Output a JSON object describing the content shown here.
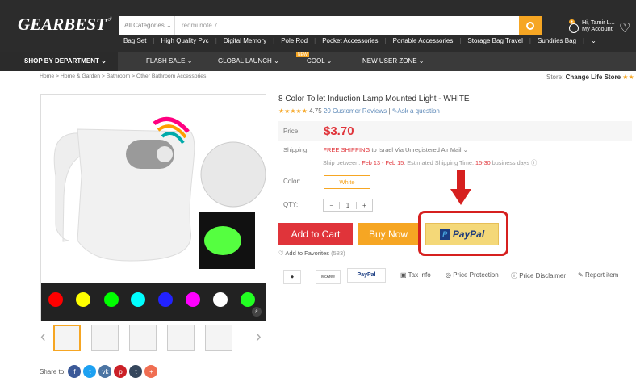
{
  "header": {
    "logo": "GEARBEST",
    "search_category": "All Categories",
    "search_query": "redmi note 7",
    "hot_searches": [
      "Bag Set",
      "High Quality Pvc",
      "Digital Memory",
      "Pole Rod",
      "Pocket Accessories",
      "Portable Accessories",
      "Storage Bag Travel",
      "Sundries Bag"
    ],
    "account_greeting": "Hi, Tamir L...",
    "account_label": "My Account"
  },
  "nav": {
    "shop": "SHOP BY DEPARTMENT",
    "items": [
      "FLASH SALE",
      "GLOBAL LAUNCH",
      "COOL",
      "NEW USER ZONE"
    ],
    "cool_badge": "NEW"
  },
  "breadcrumb": "Home > Home & Garden > Bathroom > Other Bathroom Accessories",
  "store": {
    "label": "Store:",
    "name": "Change Life Store"
  },
  "product": {
    "title": "8 Color Toilet Induction Lamp Mounted Light - WHITE",
    "rating": "4.75",
    "reviews": "20 Customer Reviews",
    "ask": "Ask a question",
    "price_label": "Price:",
    "price": "$3.70",
    "shipping_label": "Shipping:",
    "shipping_free": "FREE SHIPPING",
    "shipping_to": "to Israel Via Unregistered Air Mail",
    "ship_between_text": "Ship between:",
    "ship_between_dates": "Feb 13 - Feb 15",
    "estimated_label": "Estimated Shipping Time:",
    "estimated_days": "15-30",
    "days_label": "business days",
    "color_label": "Color:",
    "color_value": "White",
    "qty_label": "QTY:",
    "qty": "1",
    "add_to_cart": "Add to Cart",
    "buy_now": "Buy Now",
    "paypal": "PayPal",
    "favorites": "Add to Favorites",
    "favorites_count": "(583)",
    "links": [
      "Tax Info",
      "Price Protection",
      "Price Disclaimer",
      "Report item"
    ]
  },
  "share": {
    "label": "Share to:",
    "networks": [
      "f",
      "t",
      "vk",
      "p",
      "t",
      "+"
    ]
  },
  "colors": {
    "brand": "#f6a623",
    "red": "#e0343a",
    "dark": "#2c2c2c"
  }
}
